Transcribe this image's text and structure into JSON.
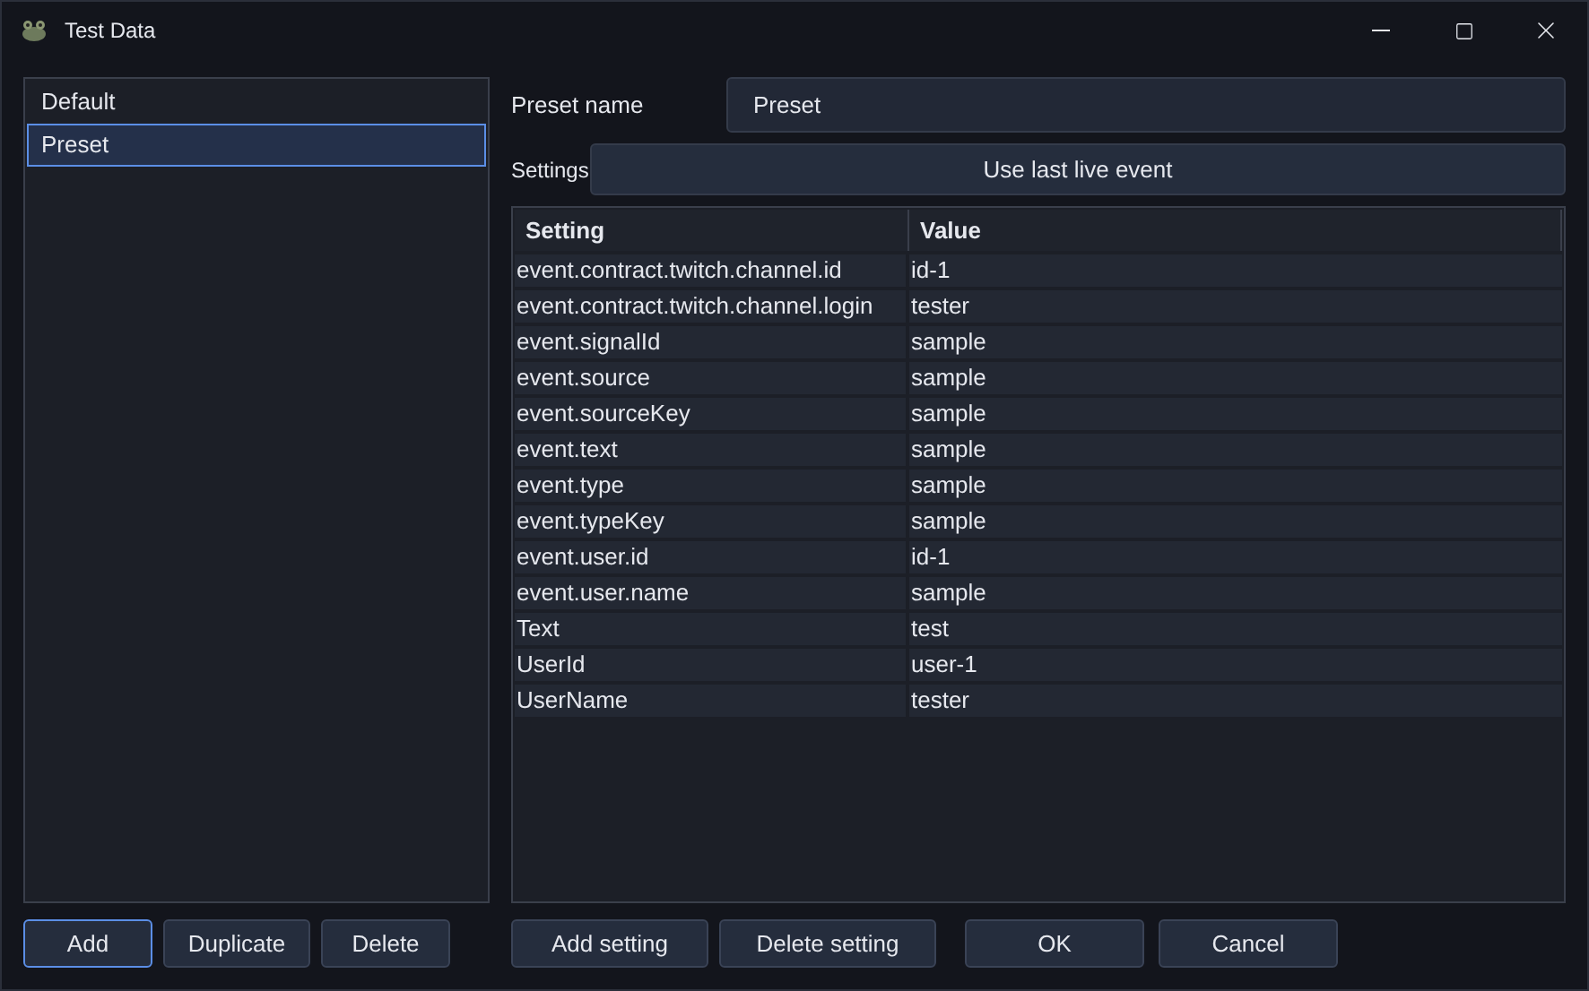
{
  "window": {
    "title": "Test Data"
  },
  "presets": [
    {
      "label": "Default",
      "selected": false
    },
    {
      "label": "Preset",
      "selected": true
    }
  ],
  "preset_name": {
    "label": "Preset name",
    "value": "Preset"
  },
  "settings": {
    "label": "Settings",
    "button": "Use last live event"
  },
  "table": {
    "columns": [
      "Setting",
      "Value"
    ],
    "rows": [
      [
        "event.contract.twitch.channel.id",
        "id-1"
      ],
      [
        "event.contract.twitch.channel.login",
        "tester"
      ],
      [
        "event.signalId",
        "sample"
      ],
      [
        "event.source",
        "sample"
      ],
      [
        "event.sourceKey",
        "sample"
      ],
      [
        "event.text",
        "sample"
      ],
      [
        "event.type",
        "sample"
      ],
      [
        "event.typeKey",
        "sample"
      ],
      [
        "event.user.id",
        "id-1"
      ],
      [
        "event.user.name",
        "sample"
      ],
      [
        "Text",
        "test"
      ],
      [
        "UserId",
        "user-1"
      ],
      [
        "UserName",
        "tester"
      ]
    ]
  },
  "left_buttons": [
    {
      "label": "Add",
      "focused": true
    },
    {
      "label": "Duplicate",
      "focused": false
    },
    {
      "label": "Delete",
      "focused": false
    }
  ],
  "right_buttons": [
    {
      "label": "Add setting",
      "focused": false
    },
    {
      "label": "Delete setting",
      "focused": false
    }
  ],
  "dialog_buttons": [
    {
      "label": "OK",
      "focused": false
    },
    {
      "label": "Cancel",
      "focused": false
    }
  ]
}
